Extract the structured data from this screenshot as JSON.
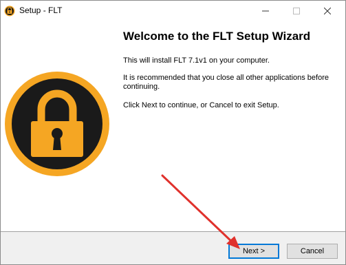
{
  "window": {
    "title": "Setup - FLT"
  },
  "main": {
    "heading": "Welcome to the FLT Setup Wizard",
    "line1": "This will install FLT 7.1v1 on your computer.",
    "line2": "It is recommended that you close all other applications before continuing.",
    "line3": "Click Next to continue, or Cancel to exit Setup."
  },
  "buttons": {
    "next": "Next >",
    "cancel": "Cancel"
  },
  "colors": {
    "logo_ring": "#f5a623",
    "logo_fill": "#1a1a1a",
    "arrow": "#e0312c",
    "focus": "#0078d7"
  },
  "icons": [
    "padlock-logo-icon",
    "minimize-icon",
    "maximize-icon",
    "close-icon",
    "annotation-arrow"
  ]
}
